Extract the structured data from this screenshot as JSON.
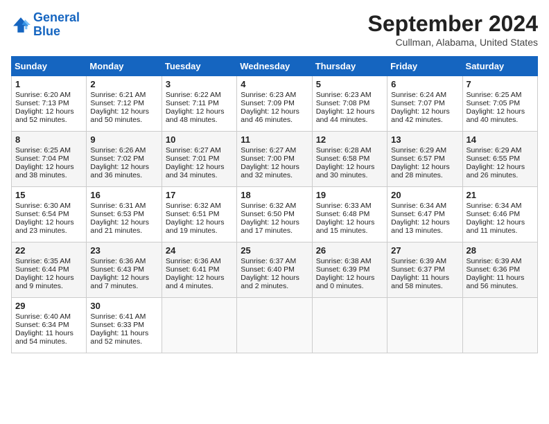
{
  "header": {
    "logo_line1": "General",
    "logo_line2": "Blue",
    "month": "September 2024",
    "location": "Cullman, Alabama, United States"
  },
  "days_of_week": [
    "Sunday",
    "Monday",
    "Tuesday",
    "Wednesday",
    "Thursday",
    "Friday",
    "Saturday"
  ],
  "weeks": [
    [
      {
        "day": "1",
        "sunrise": "Sunrise: 6:20 AM",
        "sunset": "Sunset: 7:13 PM",
        "daylight": "Daylight: 12 hours and 52 minutes."
      },
      {
        "day": "2",
        "sunrise": "Sunrise: 6:21 AM",
        "sunset": "Sunset: 7:12 PM",
        "daylight": "Daylight: 12 hours and 50 minutes."
      },
      {
        "day": "3",
        "sunrise": "Sunrise: 6:22 AM",
        "sunset": "Sunset: 7:11 PM",
        "daylight": "Daylight: 12 hours and 48 minutes."
      },
      {
        "day": "4",
        "sunrise": "Sunrise: 6:23 AM",
        "sunset": "Sunset: 7:09 PM",
        "daylight": "Daylight: 12 hours and 46 minutes."
      },
      {
        "day": "5",
        "sunrise": "Sunrise: 6:23 AM",
        "sunset": "Sunset: 7:08 PM",
        "daylight": "Daylight: 12 hours and 44 minutes."
      },
      {
        "day": "6",
        "sunrise": "Sunrise: 6:24 AM",
        "sunset": "Sunset: 7:07 PM",
        "daylight": "Daylight: 12 hours and 42 minutes."
      },
      {
        "day": "7",
        "sunrise": "Sunrise: 6:25 AM",
        "sunset": "Sunset: 7:05 PM",
        "daylight": "Daylight: 12 hours and 40 minutes."
      }
    ],
    [
      {
        "day": "8",
        "sunrise": "Sunrise: 6:25 AM",
        "sunset": "Sunset: 7:04 PM",
        "daylight": "Daylight: 12 hours and 38 minutes."
      },
      {
        "day": "9",
        "sunrise": "Sunrise: 6:26 AM",
        "sunset": "Sunset: 7:02 PM",
        "daylight": "Daylight: 12 hours and 36 minutes."
      },
      {
        "day": "10",
        "sunrise": "Sunrise: 6:27 AM",
        "sunset": "Sunset: 7:01 PM",
        "daylight": "Daylight: 12 hours and 34 minutes."
      },
      {
        "day": "11",
        "sunrise": "Sunrise: 6:27 AM",
        "sunset": "Sunset: 7:00 PM",
        "daylight": "Daylight: 12 hours and 32 minutes."
      },
      {
        "day": "12",
        "sunrise": "Sunrise: 6:28 AM",
        "sunset": "Sunset: 6:58 PM",
        "daylight": "Daylight: 12 hours and 30 minutes."
      },
      {
        "day": "13",
        "sunrise": "Sunrise: 6:29 AM",
        "sunset": "Sunset: 6:57 PM",
        "daylight": "Daylight: 12 hours and 28 minutes."
      },
      {
        "day": "14",
        "sunrise": "Sunrise: 6:29 AM",
        "sunset": "Sunset: 6:55 PM",
        "daylight": "Daylight: 12 hours and 26 minutes."
      }
    ],
    [
      {
        "day": "15",
        "sunrise": "Sunrise: 6:30 AM",
        "sunset": "Sunset: 6:54 PM",
        "daylight": "Daylight: 12 hours and 23 minutes."
      },
      {
        "day": "16",
        "sunrise": "Sunrise: 6:31 AM",
        "sunset": "Sunset: 6:53 PM",
        "daylight": "Daylight: 12 hours and 21 minutes."
      },
      {
        "day": "17",
        "sunrise": "Sunrise: 6:32 AM",
        "sunset": "Sunset: 6:51 PM",
        "daylight": "Daylight: 12 hours and 19 minutes."
      },
      {
        "day": "18",
        "sunrise": "Sunrise: 6:32 AM",
        "sunset": "Sunset: 6:50 PM",
        "daylight": "Daylight: 12 hours and 17 minutes."
      },
      {
        "day": "19",
        "sunrise": "Sunrise: 6:33 AM",
        "sunset": "Sunset: 6:48 PM",
        "daylight": "Daylight: 12 hours and 15 minutes."
      },
      {
        "day": "20",
        "sunrise": "Sunrise: 6:34 AM",
        "sunset": "Sunset: 6:47 PM",
        "daylight": "Daylight: 12 hours and 13 minutes."
      },
      {
        "day": "21",
        "sunrise": "Sunrise: 6:34 AM",
        "sunset": "Sunset: 6:46 PM",
        "daylight": "Daylight: 12 hours and 11 minutes."
      }
    ],
    [
      {
        "day": "22",
        "sunrise": "Sunrise: 6:35 AM",
        "sunset": "Sunset: 6:44 PM",
        "daylight": "Daylight: 12 hours and 9 minutes."
      },
      {
        "day": "23",
        "sunrise": "Sunrise: 6:36 AM",
        "sunset": "Sunset: 6:43 PM",
        "daylight": "Daylight: 12 hours and 7 minutes."
      },
      {
        "day": "24",
        "sunrise": "Sunrise: 6:36 AM",
        "sunset": "Sunset: 6:41 PM",
        "daylight": "Daylight: 12 hours and 4 minutes."
      },
      {
        "day": "25",
        "sunrise": "Sunrise: 6:37 AM",
        "sunset": "Sunset: 6:40 PM",
        "daylight": "Daylight: 12 hours and 2 minutes."
      },
      {
        "day": "26",
        "sunrise": "Sunrise: 6:38 AM",
        "sunset": "Sunset: 6:39 PM",
        "daylight": "Daylight: 12 hours and 0 minutes."
      },
      {
        "day": "27",
        "sunrise": "Sunrise: 6:39 AM",
        "sunset": "Sunset: 6:37 PM",
        "daylight": "Daylight: 11 hours and 58 minutes."
      },
      {
        "day": "28",
        "sunrise": "Sunrise: 6:39 AM",
        "sunset": "Sunset: 6:36 PM",
        "daylight": "Daylight: 11 hours and 56 minutes."
      }
    ],
    [
      {
        "day": "29",
        "sunrise": "Sunrise: 6:40 AM",
        "sunset": "Sunset: 6:34 PM",
        "daylight": "Daylight: 11 hours and 54 minutes."
      },
      {
        "day": "30",
        "sunrise": "Sunrise: 6:41 AM",
        "sunset": "Sunset: 6:33 PM",
        "daylight": "Daylight: 11 hours and 52 minutes."
      },
      null,
      null,
      null,
      null,
      null
    ]
  ]
}
